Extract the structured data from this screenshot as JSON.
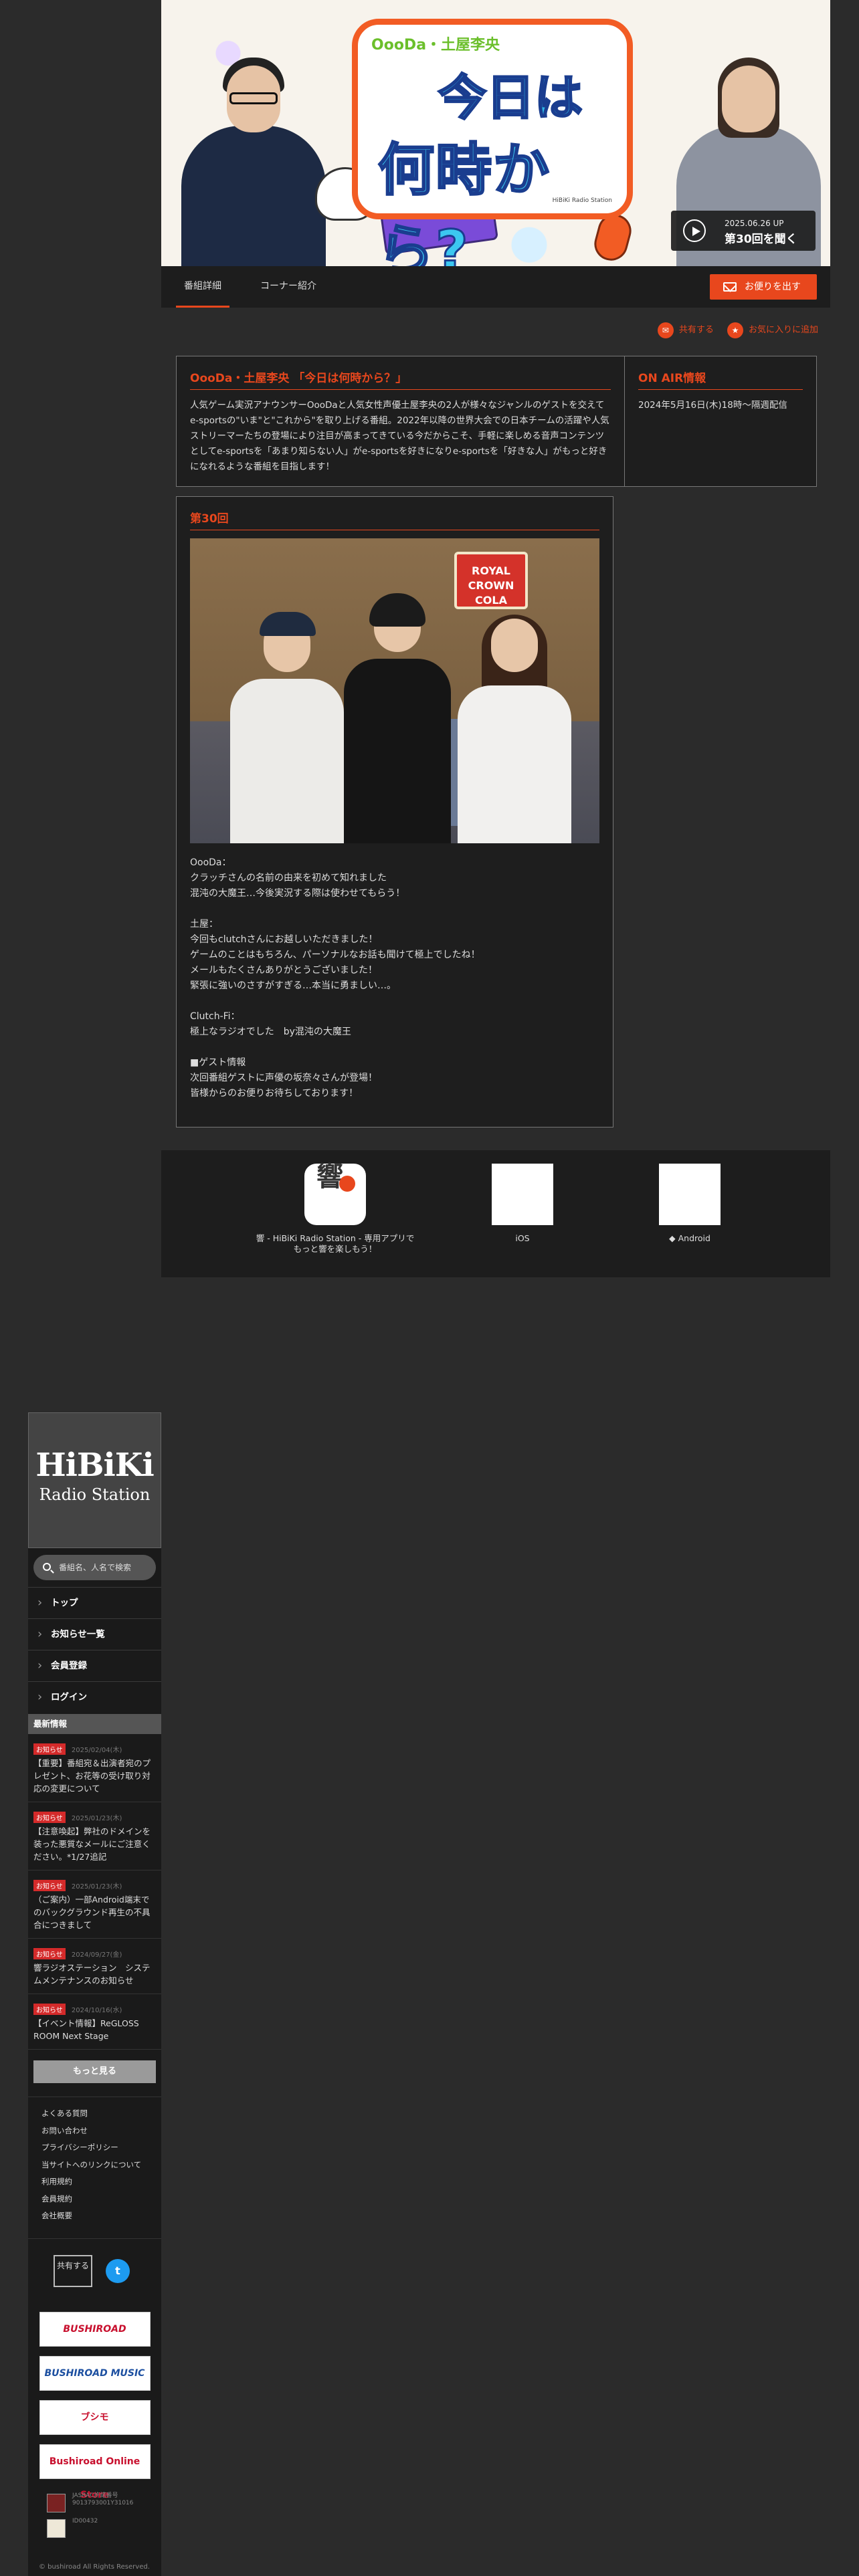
{
  "hero": {
    "subtitle_art": "OooDa・土屋李央",
    "title_art_line1": "今日は",
    "title_art_line2": "何時から?",
    "credit": "HiBiKi Radio Station",
    "play_date": "2025.06.26 UP",
    "play_label": "第30回を聞く"
  },
  "tabs": [
    {
      "label": "番組詳細"
    },
    {
      "label": "コーナー紹介"
    }
  ],
  "mail_button": "お便りを出す",
  "share": {
    "share_label": "共有する",
    "favorite_label": "お気に入りに追加"
  },
  "program": {
    "title": "OooDa・土屋李央 「今日は何時から？」",
    "description": "人気ゲーム実況アナウンサーOooDaと人気女性声優土屋李央の2人が様々なジャンルのゲストを交えてe-sportsの\"いま\"と\"これから\"を取り上げる番組。2022年以降の世界大会での日本チームの活躍や人気ストリーマーたちの登場により注目が高まってきている今だからこそ、手軽に楽しめる音声コンテンツとしてe-sportsを「あまり知らない人」がe-sportsを好きになりe-sportsを「好きな人」がもっと好きになれるような番組を目指します！",
    "onair_title": "ON AIR情報",
    "onair_text": "2024年5月16日(木)18時〜隔週配信"
  },
  "episode": {
    "title": "第30回",
    "sign_text": "ROYAL CROWN COLA",
    "body": "OooDa：\nクラッチさんの名前の由来を初めて知れました\n混沌の大魔王…今後実況する際は使わせてもらう！\n\n土屋：\n今回もclutchさんにお越しいただきました！\nゲームのことはもちろん、パーソナルなお話も聞けて極上でしたね！\nメールもたくさんありがとうございました！\n緊張に強いのさすがすぎる…本当に勇ましい…。\n\nClutch-Fi：\n極上なラジオでした　by混沌の大魔王\n\n■ゲスト情報\n次回番組ゲストに声優の坂奈々さんが登場！\n皆様からのお便りお待ちしております！"
  },
  "app_promo": {
    "app_text_line1": "響 - HiBiKi Radio Station - 専用アプリで",
    "app_text_line2": "もっと響を楽しもう！",
    "app_icon_caption": "HiBiKi Radio Station",
    "ios_label": " iOS",
    "android_label": "◆ Android"
  },
  "sidebar": {
    "logo_line1": "HiBiKi",
    "logo_line2": "Radio Station",
    "search_placeholder": "番組名、人名で検索",
    "nav": [
      {
        "label": "トップ"
      },
      {
        "label": "お知らせ一覧"
      },
      {
        "label": "会員登録"
      },
      {
        "label": "ログイン"
      }
    ],
    "news_heading": "最新情報",
    "news": [
      {
        "tag": "お知らせ",
        "date": "2025/02/04(木)",
        "title": "【重要】番組宛＆出演者宛のプレゼント、お花等の受け取り対応の変更について"
      },
      {
        "tag": "お知らせ",
        "date": "2025/01/23(木)",
        "title": "【注意喚起】弊社のドメインを装った悪質なメールにご注意ください。*1/27追記"
      },
      {
        "tag": "お知らせ",
        "date": "2025/01/23(木)",
        "title": "（ご案内）一部Android端末でのバックグラウンド再生の不具合につきまして"
      },
      {
        "tag": "お知らせ",
        "date": "2024/09/27(金)",
        "title": "響ラジオステーション　システムメンテナンスのお知らせ"
      },
      {
        "tag": "お知らせ",
        "date": "2024/10/16(水)",
        "title": "【イベント情報】ReGLOSS ROOM Next Stage"
      }
    ],
    "more_label": "もっと見る",
    "footer_links": [
      "よくある質問",
      "お問い合わせ",
      "プライバシーポリシー",
      "当サイトへのリンクについて",
      "利用規約",
      "会員規約",
      "会社概要"
    ],
    "share_btn": "共有する",
    "twitter_icon": "t",
    "banners": [
      "BUSHIROAD",
      "BUSHIROAD MUSIC",
      "ブシモ",
      "Bushiroad Online Store"
    ],
    "cert1": "JASRAC許諾番号\n9013793001Y31016",
    "cert2": "ID00432",
    "copyright": "© bushiroad All Rights Reserved."
  },
  "colors": {
    "accent": "#e8471d",
    "background": "#2b2b2b",
    "panel": "#1e1e1e"
  }
}
